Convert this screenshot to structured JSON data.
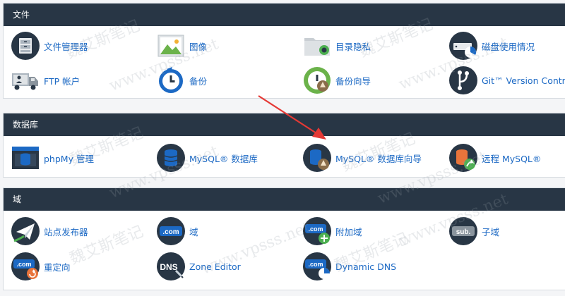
{
  "sections": {
    "files": {
      "title": "文件",
      "items": {
        "file_manager": "文件管理器",
        "images": "图像",
        "directory_privacy": "目录隐私",
        "disk_usage": "磁盘使用情况",
        "ftp_accounts": "FTP 帐户",
        "backup": "备份",
        "backup_wizard": "备份向导",
        "git_version_control": "Git™ Version Control"
      }
    },
    "databases": {
      "title": "数据库",
      "items": {
        "phpmyadmin": "phpMy 管理",
        "mysql_databases": "MySQL® 数据库",
        "mysql_database_wizard": "MySQL® 数据库向导",
        "remote_mysql": "远程 MySQL®"
      }
    },
    "domains": {
      "title": "域",
      "items": {
        "site_publisher": "站点发布器",
        "domains": "域",
        "addon_domains": "附加域",
        "subdomains": "子域",
        "redirects": "重定向",
        "zone_editor": "Zone Editor",
        "dynamic_dns": "Dynamic DNS"
      }
    }
  },
  "icon_text": {
    "com": ".com",
    "sub": "sub.",
    "dns": "DNS"
  },
  "watermark": {
    "cn": "魏艾斯笔记",
    "url": "www.vpsss.net"
  },
  "colors": {
    "header_bg": "#283645",
    "link": "#1c69c4",
    "arrow": "#e53935",
    "icon_dark": "#283645",
    "icon_blue": "#1c69c4",
    "icon_green": "#4caf50",
    "icon_orange": "#e8743b"
  }
}
